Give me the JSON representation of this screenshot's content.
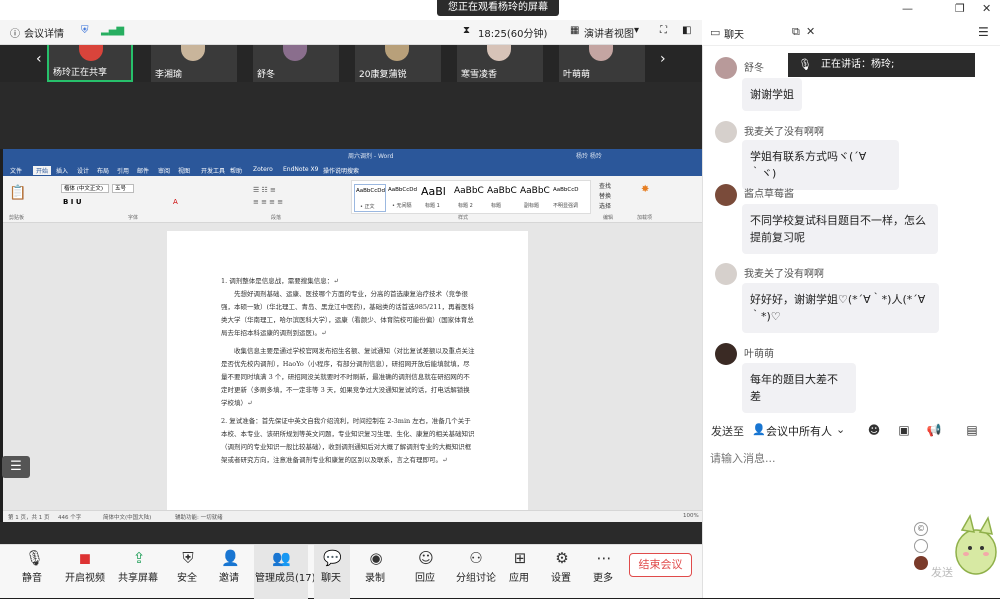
{
  "top": {
    "meeting_details": "会议详情",
    "share_banner": "您正在观看杨玲的屏幕",
    "duration": "18:25(60分钟)",
    "presenter_view": "演讲者视图",
    "chat_title": "聊天"
  },
  "video_strip": {
    "tiles": [
      {
        "label": "杨玲正在共享"
      },
      {
        "label": "李湘瑜"
      },
      {
        "label": "舒冬"
      },
      {
        "label": "20康复蒲锐"
      },
      {
        "label": "寒雪凌香"
      },
      {
        "label": "叶萌萌"
      }
    ]
  },
  "word": {
    "title": "周六调剂 - Word",
    "user": "杨玲 杨玲",
    "tabs": [
      "文件",
      "开始",
      "插入",
      "设计",
      "布局",
      "引用",
      "邮件",
      "审阅",
      "视图",
      "开发工具",
      "帮助",
      "Zotero",
      "帮助",
      "EndNote X9",
      "操作说明搜索"
    ],
    "font_name": "楷体 (中文正文)",
    "font_size": "五号",
    "styles": [
      "AaBbCcDd",
      "AaBbCcDd",
      "AaBl",
      "AaBbC",
      "AaBbC",
      "AaBbC",
      "AaBbCcD"
    ],
    "style_names": [
      "• 正文",
      "• 无间隔",
      "标题 1",
      "标题 2",
      "标题",
      "副标题",
      "不明显强调"
    ],
    "groups": [
      "剪贴板",
      "字体",
      "段落",
      "样式",
      "编辑",
      "加载项"
    ],
    "edit_items": [
      "查找",
      "替换",
      "选择"
    ],
    "paragraphs": [
      "1. 调剂整体是信息战，需要搜集信息：↵",
      "先想好调剂基础、运康、医技哪个方面的专业，分高的首选康复治疗技术（竞争很强，本硕一致）(华北理工、青岛、黑龙江中医药)，基础类的话首选985/211，再着医科类大学（华南理工，哈尔滨医科大学），运康（看颜少、体育院校可能份偏）(国家体育总局去年招本科运康的调剂到运医)。↵",
      "收集信息主要是通过学校官网发布招生名额、复试通知（对比复试差额以及重点关注是否优先校内调剂），HaoYo（小程序，有部分调剂信息），研招网开放后能填就填，尽量不要同时填满 3 个，研招网没关就要时不时刷新，最准确的调剂信息就在研招网的不定时更新（多刷多填，不一定非等 3 天，如果竞争过大没通知复试的话，打电话解锁换学校填）↵",
      "2. 复试准备：首先保证中英文自我介绍流利，时间控制在 2-3min 左右，准备几个关于本校、本专业、该研所规划等英文问题，专业知识复习生理、生化、康复的相关基础知识（调剂问的专业知识一般比较基础），收到调剂通知后对大概了解调剂专业的大概知识框架或者研究方向，注意准备调剂专业和康复的区别以及联系，言之有理即可。↵"
    ],
    "status": {
      "page": "第 1 页，共 1 页",
      "words": "446 个字",
      "lang": "简体中文(中国大陆)",
      "accessibility": "辅助功能: 一切就绪",
      "zoom": "100%"
    }
  },
  "bottom": {
    "buttons": [
      "静音",
      "开启视频",
      "共享屏幕",
      "安全",
      "邀请",
      "管理成员(17)",
      "聊天",
      "录制",
      "回应",
      "分组讨论",
      "应用",
      "设置",
      "更多"
    ],
    "end_meeting": "结束会议"
  },
  "chat": {
    "speaking": "正在讲话：杨玲;",
    "messages": [
      {
        "name": "舒冬",
        "text": "谢谢学姐"
      },
      {
        "name": "我麦关了没有啊啊",
        "text": "学姐有联系方式吗ヾ(´∀｀ヾ)"
      },
      {
        "name": "酱点草莓酱",
        "text": "不同学校复试科目题目不一样，怎么提前复习呢"
      },
      {
        "name": "我麦关了没有啊啊",
        "text": "好好好，谢谢学姐♡(*´∀｀*)人(*´∀｀*)♡"
      },
      {
        "name": "叶萌萌",
        "text": "每年的题目大差不差"
      }
    ],
    "send_to_label": "发送至",
    "send_to_target": "会议中所有人",
    "input_placeholder": "请输入消息...",
    "send_button": "发送"
  },
  "colors": {
    "word_blue": "#2b579a",
    "end_red": "#e04b4b",
    "bubble": "#f1f1f4"
  }
}
